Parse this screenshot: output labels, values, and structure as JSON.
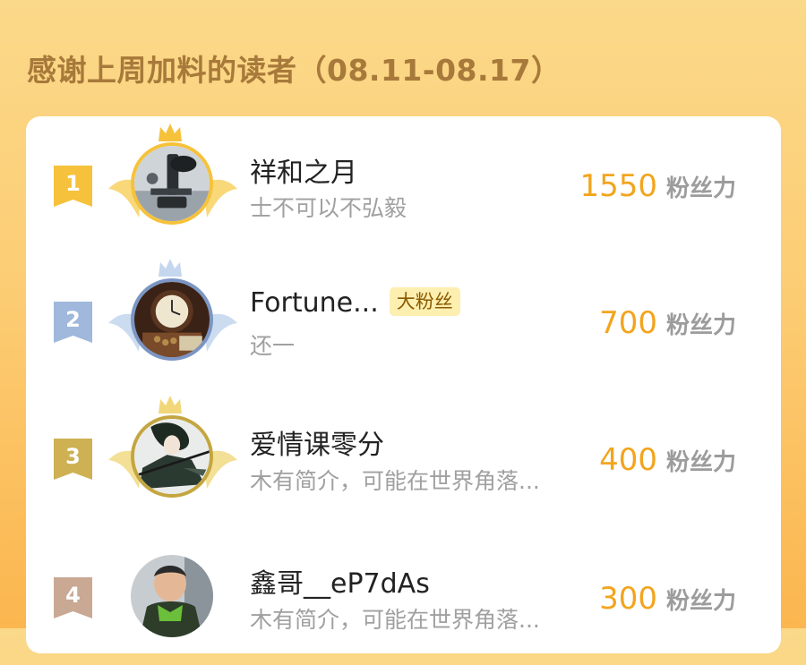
{
  "header": {
    "title": "感谢上周加料的读者（08.11-08.17）"
  },
  "colors": {
    "gold": "#f6c23b",
    "silver": "#9fb8dc",
    "bronze": "#cdb152",
    "fourth": "#c9a894",
    "score": "#f2a51d"
  },
  "ranking": [
    {
      "rank": "1",
      "name": "祥和之月",
      "badge": "",
      "bio": "士不可以不弘毅",
      "score": "1550",
      "unit": "粉丝力",
      "avatar_icon": "microscope-image"
    },
    {
      "rank": "2",
      "name": "Fortune...",
      "badge": "大粉丝",
      "bio": "还一",
      "score": "700",
      "unit": "粉丝力",
      "avatar_icon": "antique-clock-image"
    },
    {
      "rank": "3",
      "name": "爱情课零分",
      "badge": "",
      "bio": "木有简介，可能在世界角落...",
      "score": "400",
      "unit": "粉丝力",
      "avatar_icon": "anime-character-image"
    },
    {
      "rank": "4",
      "name": "鑫哥__eP7dAs",
      "badge": "",
      "bio": "木有简介，可能在世界角落...",
      "score": "300",
      "unit": "粉丝力",
      "avatar_icon": "person-photo-image"
    }
  ]
}
